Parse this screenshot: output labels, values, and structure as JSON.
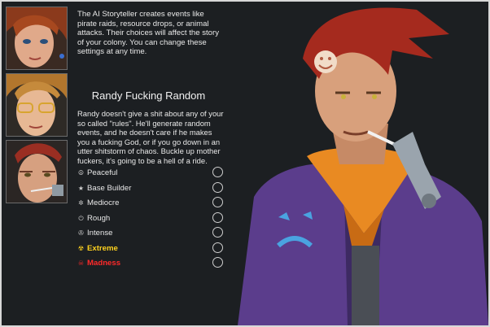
{
  "storyteller": {
    "intro": "The AI Storyteller creates events like pirate raids, resource drops, or animal attacks. Their choices will affect the story of your colony. You can change these settings at any time.",
    "portraits": [
      {
        "id": "cassandra",
        "selected": false
      },
      {
        "id": "phoebe",
        "selected": false
      },
      {
        "id": "randy",
        "selected": true
      }
    ],
    "name": "Randy Fucking Random",
    "description": "Randy doesn't give a shit about any of your so called \"rules\". He'll generate random events, and he doesn't care if he makes you a fucking God, or if you go down in an utter shitstorm of chaos. Buckle up mother fuckers, it's going to be a hell of a ride."
  },
  "difficulties": [
    {
      "label": "Peaceful",
      "icon": "peace-icon",
      "color": "#e6e6e6"
    },
    {
      "label": "Base Builder",
      "icon": "star-icon",
      "color": "#e6e6e6"
    },
    {
      "label": "Mediocre",
      "icon": "gear-icon",
      "color": "#e6e6e6"
    },
    {
      "label": "Rough",
      "icon": "power-icon",
      "color": "#e6e6e6"
    },
    {
      "label": "Intense",
      "icon": "mercedes-icon",
      "color": "#e6e6e6"
    },
    {
      "label": "Extreme",
      "icon": "radiation-icon",
      "color": "#ffd21f"
    },
    {
      "label": "Madness",
      "icon": "skull-icon",
      "color": "#ff2a2a"
    }
  ]
}
